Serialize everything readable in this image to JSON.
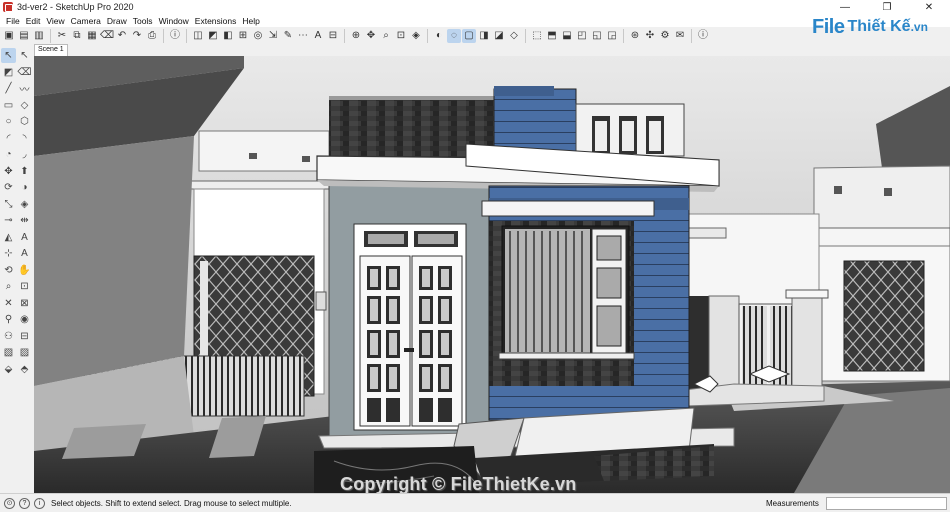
{
  "window": {
    "title": "3d-ver2 - SketchUp Pro 2020",
    "controls": {
      "minimize": "—",
      "maximize": "❐",
      "close": "✕"
    }
  },
  "menu": [
    "File",
    "Edit",
    "View",
    "Camera",
    "Draw",
    "Tools",
    "Window",
    "Extensions",
    "Help"
  ],
  "toolbar": {
    "icons": [
      "new-icon",
      "open-icon",
      "save-icon",
      "cut-icon",
      "copy-icon",
      "paste-icon",
      "erase-icon",
      "undo-icon",
      "redo-icon",
      "print-icon",
      "model-info-icon",
      "select-icon",
      "paint-icon",
      "push-pull-icon",
      "move-icon",
      "rotate-icon",
      "scale-icon",
      "tape-icon",
      "dimension-icon",
      "text-icon",
      "section-icon",
      "orbit-icon",
      "pan-icon",
      "zoom-icon",
      "zoom-extents-icon",
      "styles-icon",
      "xray-icon",
      "wireframe-icon",
      "hidden-line-icon",
      "shaded-icon",
      "textured-icon",
      "monochrome-icon",
      "iso-view-icon",
      "top-view-icon",
      "front-view-icon",
      "right-view-icon",
      "back-view-icon",
      "left-view-icon",
      "warehouse-icon",
      "extension-icon",
      "layout-icon",
      "send-icon",
      "info-icon"
    ],
    "glyphs": [
      "▣",
      "▤",
      "▥",
      "✂",
      "⧉",
      "▦",
      "⌫",
      "↶",
      "↷",
      "⎙",
      "ⓘ",
      "◫",
      "◩",
      "◧",
      "⊞",
      "◎",
      "⇲",
      "✎",
      "⋯",
      "A",
      "⊟",
      "⊕",
      "✥",
      "⌕",
      "⊡",
      "◈",
      "◐",
      "◌",
      "▢",
      "◨",
      "◪",
      "◇",
      "⬚",
      "⬒",
      "⬓",
      "◰",
      "◱",
      "◲",
      "⊛",
      "✣",
      "⚙",
      "✉",
      "ⓘ"
    ]
  },
  "logo": {
    "brand": "File",
    "rest": "Thiết Kế",
    "suffix": ".vn"
  },
  "scene_tabs": [
    "Scene 1"
  ],
  "left_tools": [
    {
      "icon": "select-arrow-icon",
      "glyph": "↖"
    },
    {
      "icon": "select-arrow-alt-icon",
      "glyph": "↖"
    },
    {
      "icon": "paint-bucket-icon",
      "glyph": "◩"
    },
    {
      "icon": "eraser-icon",
      "glyph": "⌫"
    },
    {
      "icon": "line-icon",
      "glyph": "╱"
    },
    {
      "icon": "freehand-icon",
      "glyph": "〰"
    },
    {
      "icon": "rectangle-icon",
      "glyph": "▭"
    },
    {
      "icon": "rotated-rectangle-icon",
      "glyph": "◇"
    },
    {
      "icon": "circle-icon",
      "glyph": "○"
    },
    {
      "icon": "polygon-icon",
      "glyph": "⬡"
    },
    {
      "icon": "arc-icon",
      "glyph": "◜"
    },
    {
      "icon": "two-point-arc-icon",
      "glyph": "◝"
    },
    {
      "icon": "pie-icon",
      "glyph": "◔"
    },
    {
      "icon": "three-point-arc-icon",
      "glyph": "◞"
    },
    {
      "icon": "move-icon",
      "glyph": "✥"
    },
    {
      "icon": "push-pull-icon",
      "glyph": "⬆"
    },
    {
      "icon": "rotate-icon",
      "glyph": "⟳"
    },
    {
      "icon": "follow-me-icon",
      "glyph": "◑"
    },
    {
      "icon": "scale-icon",
      "glyph": "⤡"
    },
    {
      "icon": "offset-icon",
      "glyph": "◈"
    },
    {
      "icon": "tape-measure-icon",
      "glyph": "⊸"
    },
    {
      "icon": "dimension-icon",
      "glyph": "⇹"
    },
    {
      "icon": "protractor-icon",
      "glyph": "◭"
    },
    {
      "icon": "text-icon",
      "glyph": "A"
    },
    {
      "icon": "axes-icon",
      "glyph": "⊹"
    },
    {
      "icon": "3d-text-icon",
      "glyph": "A"
    },
    {
      "icon": "orbit-icon",
      "glyph": "⟲"
    },
    {
      "icon": "pan-icon",
      "glyph": "✋"
    },
    {
      "icon": "zoom-icon",
      "glyph": "⌕"
    },
    {
      "icon": "zoom-window-icon",
      "glyph": "⊡"
    },
    {
      "icon": "zoom-extents-icon",
      "glyph": "✕"
    },
    {
      "icon": "previous-view-icon",
      "glyph": "⊠"
    },
    {
      "icon": "position-camera-icon",
      "glyph": "⚲"
    },
    {
      "icon": "look-around-icon",
      "glyph": "◉"
    },
    {
      "icon": "walk-icon",
      "glyph": "⚇"
    },
    {
      "icon": "section-plane-icon",
      "glyph": "⊟"
    },
    {
      "icon": "sandbox-icon",
      "glyph": "▧"
    },
    {
      "icon": "sandbox-alt-icon",
      "glyph": "▨"
    },
    {
      "icon": "dynamic-component-icon",
      "glyph": "⬙"
    },
    {
      "icon": "dynamic-component-alt-icon",
      "glyph": "⬘"
    }
  ],
  "statusbar": {
    "status_text": "Select objects. Shift to extend select. Drag mouse to select multiple.",
    "measurements_label": "Measurements",
    "measurements_value": ""
  },
  "watermark": "Copyright © FileThietKe.vn",
  "colors": {
    "accent_blue": "#4a6fa5",
    "logo_blue": "#2a86c9",
    "active_tool": "#bcd4ee"
  }
}
